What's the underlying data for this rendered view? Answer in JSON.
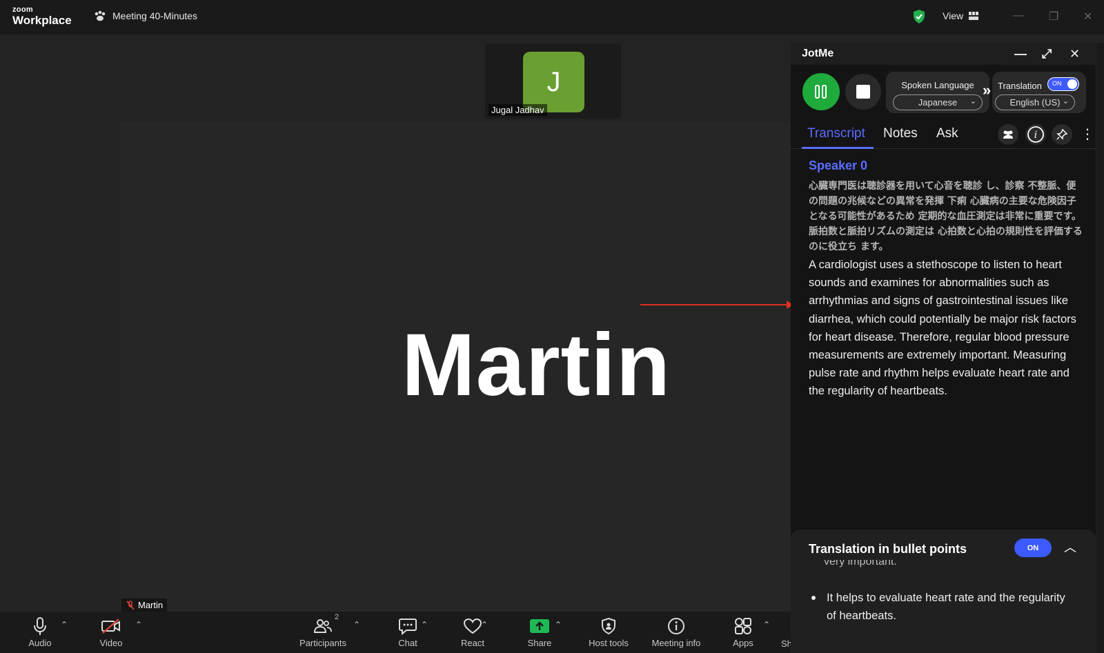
{
  "app": {
    "logo_top": "zoom",
    "logo_bottom": "Workplace",
    "meeting_title": "Meeting 40-Minutes",
    "view_label": "View"
  },
  "thumbnail": {
    "initial": "J",
    "name": "Jugal Jadhav",
    "avatar_color": "#6a9f32"
  },
  "main_video": {
    "display_name": "Martin",
    "label": "Martin"
  },
  "toolbar": {
    "audio": "Audio",
    "video": "Video",
    "participants": "Participants",
    "participants_count": "2",
    "chat": "Chat",
    "react": "React",
    "share": "Share",
    "host_tools": "Host tools",
    "meeting_info": "Meeting info",
    "apps": "Apps",
    "more_cut": "Sh"
  },
  "jotme": {
    "title": "JotMe",
    "spoken_language_label": "Spoken Language",
    "spoken_language_value": "Japanese",
    "translation_label": "Translation",
    "translation_toggle": "ON",
    "translation_value": "English (US)",
    "tabs": {
      "transcript": "Transcript",
      "notes": "Notes",
      "ask": "Ask"
    },
    "speaker": "Speaker 0",
    "japanese_text": "心臓専門医は聴診器を用いて心音を聴診 し、診察 不整脈、便の問題の兆候などの異常を発揮 下痢 心臓病の主要な危険因子となる可能性があるため 定期的な血圧測定は非常に重要です。 脈拍数と脈拍リズムの測定は 心拍数と心拍の規則性を評価するのに役立ち ます。",
    "english_text": "A cardiologist uses a stethoscope to listen to heart sounds and examines for abnormalities such as arrhythmias and signs of gastrointestinal issues like diarrhea, which could potentially be major risk factors for heart disease. Therefore, regular blood pressure measurements are extremely important. Measuring pulse rate and rhythm helps evaluate heart rate and the regularity of heartbeats.",
    "bullet_panel": {
      "title": "Translation in bullet points",
      "toggle": "ON",
      "cut_text": "very important.",
      "bullets": [
        "It helps to evaluate heart rate and the regularity of heartbeats."
      ]
    },
    "accent_color": "#3d5afe",
    "record_color": "#1faa3c"
  }
}
